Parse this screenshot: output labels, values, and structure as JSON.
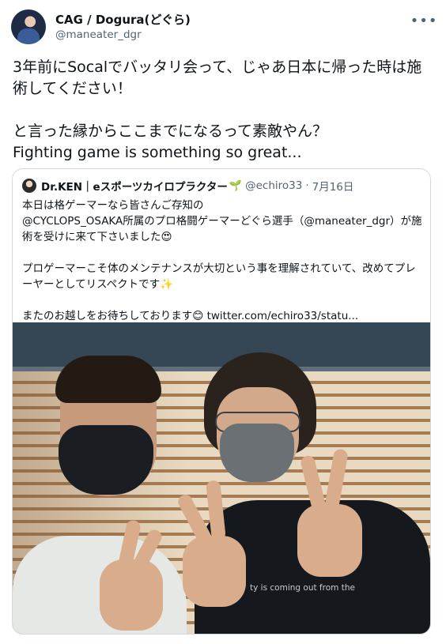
{
  "tweet": {
    "author_name": "CAG / Dogura(どぐら)",
    "author_handle": "@maneater_dgr",
    "more_icon": "more-horizontal-icon",
    "text": "3年前にSocalでバッタリ会って、じゃあ日本に帰った時は施術してください！\n\nと言った縁からここまでになるって素敵やん？\nFighting game is something so great..."
  },
  "quote": {
    "author_name": "Dr.KEN｜eスポーツカイロプラクター",
    "verified_emoji": "🌱",
    "author_handle": "@echiro33",
    "separator": "·",
    "date": "7月16日",
    "text": "本日は格ゲーマーなら皆さんご存知の\n@CYCLOPS_OSAKA所属のプロ格闘ゲーマーどぐら選手（@maneater_dgr）が施術を受けに来て下さいました😍\n\nプロゲーマーこそ体のメンテナンスが大切という事を理解されていて、改めてプレーヤーとしてリスペクトです✨\n\nまたのお越しをお待ちしております😊",
    "link_text": "twitter.com/echiro33/statu...",
    "photo_shirt_text": "ty is coming out from the"
  }
}
